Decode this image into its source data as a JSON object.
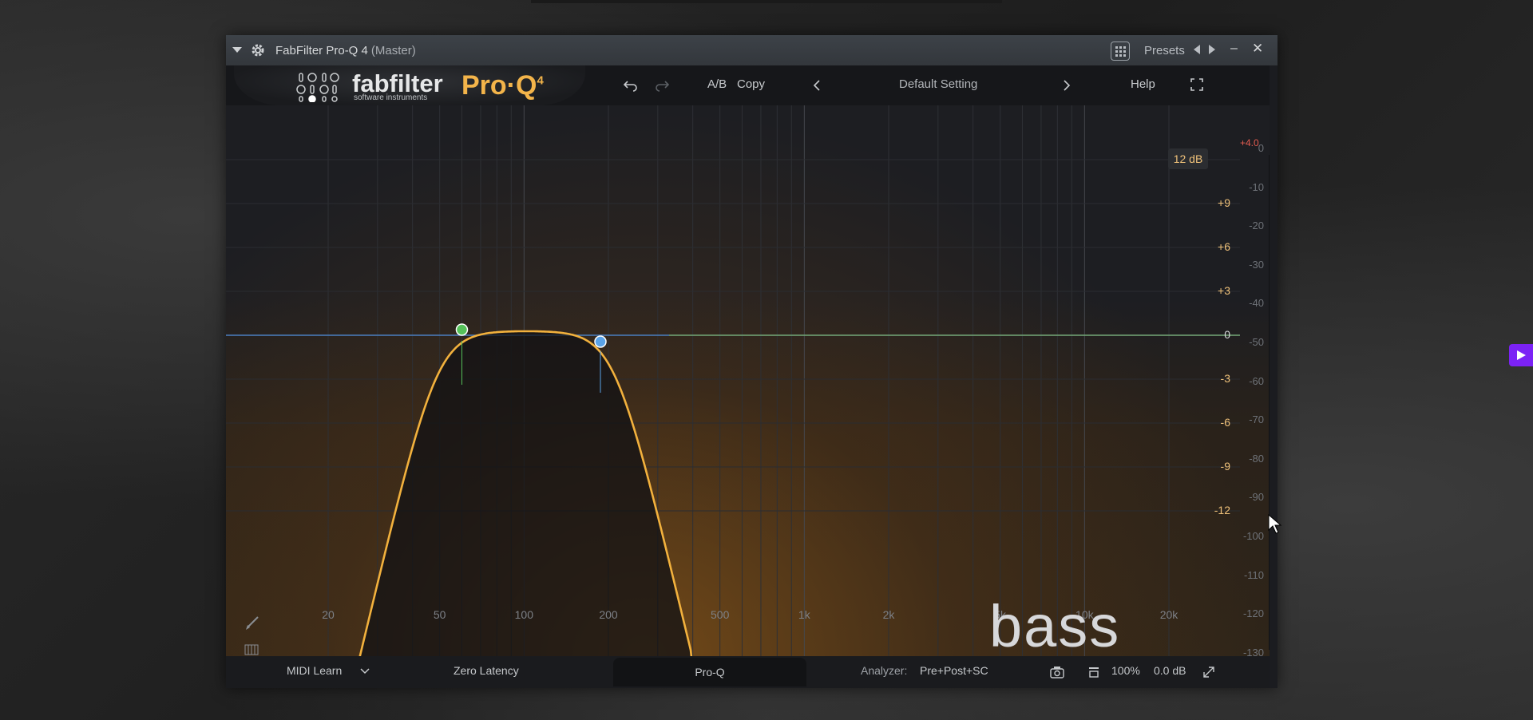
{
  "window": {
    "title": "FabFilter Pro-Q 4",
    "subtitle": "(Master)",
    "presets_label": "Presets"
  },
  "header": {
    "brand": "fabfilter",
    "brand_sub": "software instruments",
    "product": "Pro·Q",
    "product_version": "4",
    "ab_label": "A/B",
    "copy_label": "Copy",
    "preset_name": "Default Setting",
    "help_label": "Help"
  },
  "graph": {
    "scale_badge": "12 dB",
    "top_level": "+4.0",
    "gain_labels": [
      "+9",
      "+6",
      "+3",
      "0",
      "-3",
      "-6",
      "-9",
      "-12"
    ],
    "db_labels": [
      "0",
      "-10",
      "-20",
      "-30",
      "-40",
      "-50",
      "-60",
      "-70",
      "-80",
      "-90",
      "-100",
      "-110",
      "-120",
      "-130"
    ],
    "freq_labels": [
      "20",
      "50",
      "100",
      "200",
      "500",
      "1k",
      "2k",
      "5k",
      "10k",
      "20k"
    ],
    "watermark": "bass",
    "bands": [
      {
        "type": "high-pass",
        "freq_hz": 60,
        "gain_db": 0,
        "color": "#56c25a"
      },
      {
        "type": "low-pass",
        "freq_hz": 200,
        "gain_db": 0,
        "color": "#5aa3e8"
      }
    ],
    "curve_color": "#f2b13d"
  },
  "footer": {
    "midi_learn": "MIDI Learn",
    "latency": "Zero Latency",
    "tab": "Pro-Q",
    "analyzer_label": "Analyzer:",
    "analyzer_value": "Pre+Post+SC",
    "zoom": "100%",
    "output_gain": "0.0 dB"
  }
}
